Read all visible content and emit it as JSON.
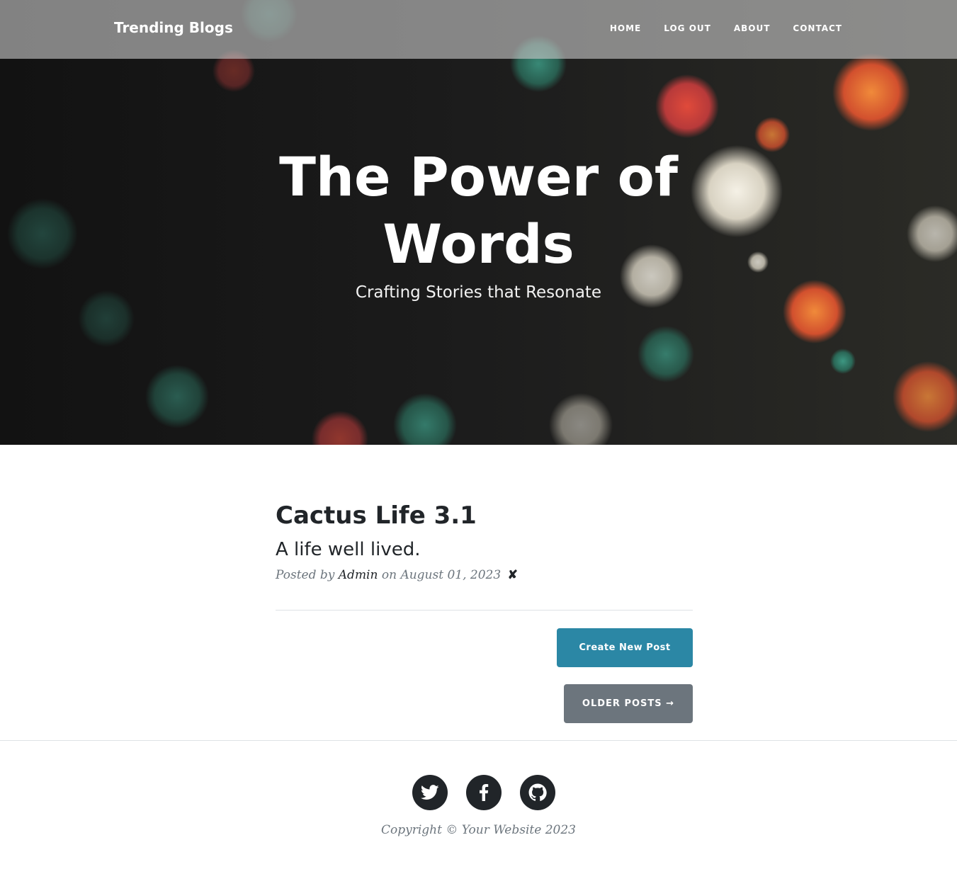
{
  "nav": {
    "brand": "Trending Blogs",
    "links": [
      "HOME",
      "LOG OUT",
      "ABOUT",
      "CONTACT"
    ]
  },
  "hero": {
    "title_line1": "The Power of",
    "title_line2": "Words",
    "subtitle": "Crafting Stories that Resonate",
    "background_image": "dark underwater photo of sea anemones"
  },
  "post": {
    "title": "Cactus Life 3.1",
    "subtitle": "A life well lived.",
    "meta_prefix": "Posted by",
    "author": "Admin",
    "meta_middle": "on",
    "date": "August 01, 2023",
    "delete_symbol": "✘"
  },
  "buttons": {
    "create": "Create New Post",
    "older": "OLDER POSTS →"
  },
  "footer": {
    "social_icons": [
      "twitter-icon",
      "facebook-icon",
      "github-icon"
    ],
    "copyright": "Copyright © Your Website 2023"
  },
  "colors": {
    "primary_button": "#2b87a5",
    "secondary_button": "#6c757d",
    "text_dark": "#212529",
    "text_muted": "#6c757d"
  }
}
